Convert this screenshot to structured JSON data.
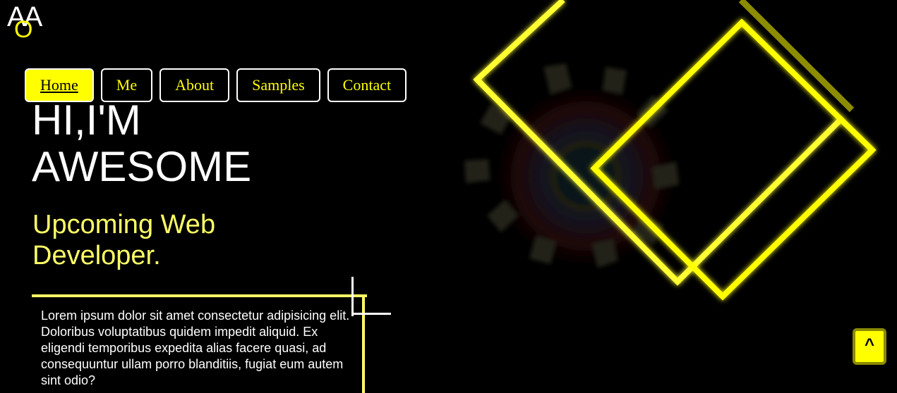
{
  "logo": {
    "main": "AA",
    "sub": "O"
  },
  "nav": {
    "items": [
      {
        "label": "Home"
      },
      {
        "label": "Me"
      },
      {
        "label": "About"
      },
      {
        "label": "Samples"
      },
      {
        "label": "Contact"
      }
    ],
    "active_item": "Home"
  },
  "hero": {
    "title_line1": "HI,I'M",
    "title_line2": "AWESOME",
    "subtitle": "Upcoming Web Developer."
  },
  "about": {
    "text": "Lorem ipsum dolor sit amet consectetur adipisicing elit. Doloribus voluptatibus quidem impedit aliquid. Ex eligendi temporibus expedita alias facere quasi, ad consequuntur ullam porro blanditiis, fugiat eum autem sint odio?"
  },
  "scroll_top": {
    "label": "^"
  },
  "colors": {
    "background": "#000000",
    "accent": "#ffff00",
    "accent_soft": "#ffff66",
    "text": "#ffffff"
  },
  "icons": {
    "scroll_top": "caret-up-icon"
  }
}
